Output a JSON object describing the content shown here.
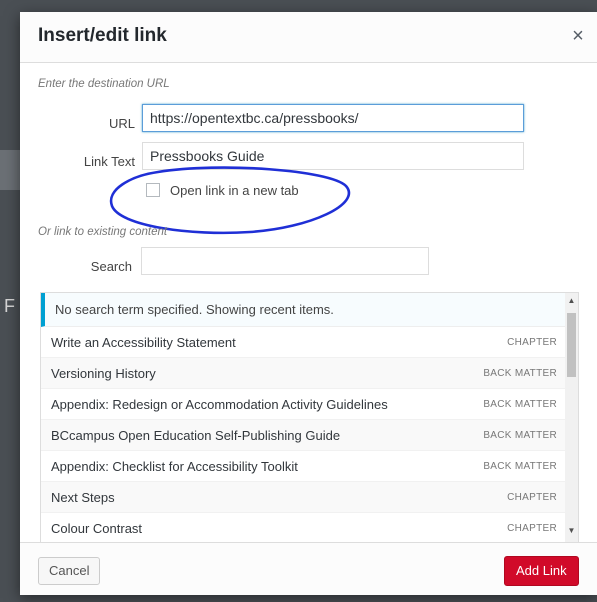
{
  "dialog": {
    "title": "Insert/edit link",
    "close_glyph": "×"
  },
  "destination": {
    "hint": "Enter the destination URL",
    "url_label": "URL",
    "url_value": "https://opentextbc.ca/pressbooks/",
    "link_text_label": "Link Text",
    "link_text_value": "Pressbooks Guide",
    "new_tab_label": "Open link in a new tab",
    "new_tab_checked": false
  },
  "existing": {
    "hint": "Or link to existing content",
    "search_label": "Search",
    "search_value": "",
    "notice": "No search term specified. Showing recent items.",
    "items": [
      {
        "title": "Write an Accessibility Statement",
        "kind": "CHAPTER"
      },
      {
        "title": "Versioning History",
        "kind": "BACK MATTER"
      },
      {
        "title": "Appendix: Redesign or Accommodation Activity Guidelines",
        "kind": "BACK MATTER"
      },
      {
        "title": "BCcampus Open Education Self-Publishing Guide",
        "kind": "BACK MATTER"
      },
      {
        "title": "Appendix: Checklist for Accessibility Toolkit",
        "kind": "BACK MATTER"
      },
      {
        "title": "Next Steps",
        "kind": "CHAPTER"
      },
      {
        "title": "Colour Contrast",
        "kind": "CHAPTER"
      }
    ]
  },
  "footer": {
    "cancel_label": "Cancel",
    "add_label": "Add Link"
  },
  "colors": {
    "accent": "#d10a29",
    "notice_border": "#00a0d2",
    "annotation": "#1f2fd6"
  },
  "icons": {
    "close": "close-icon",
    "scroll_up": "scroll-up-arrow-icon",
    "scroll_down": "scroll-down-arrow-icon"
  }
}
